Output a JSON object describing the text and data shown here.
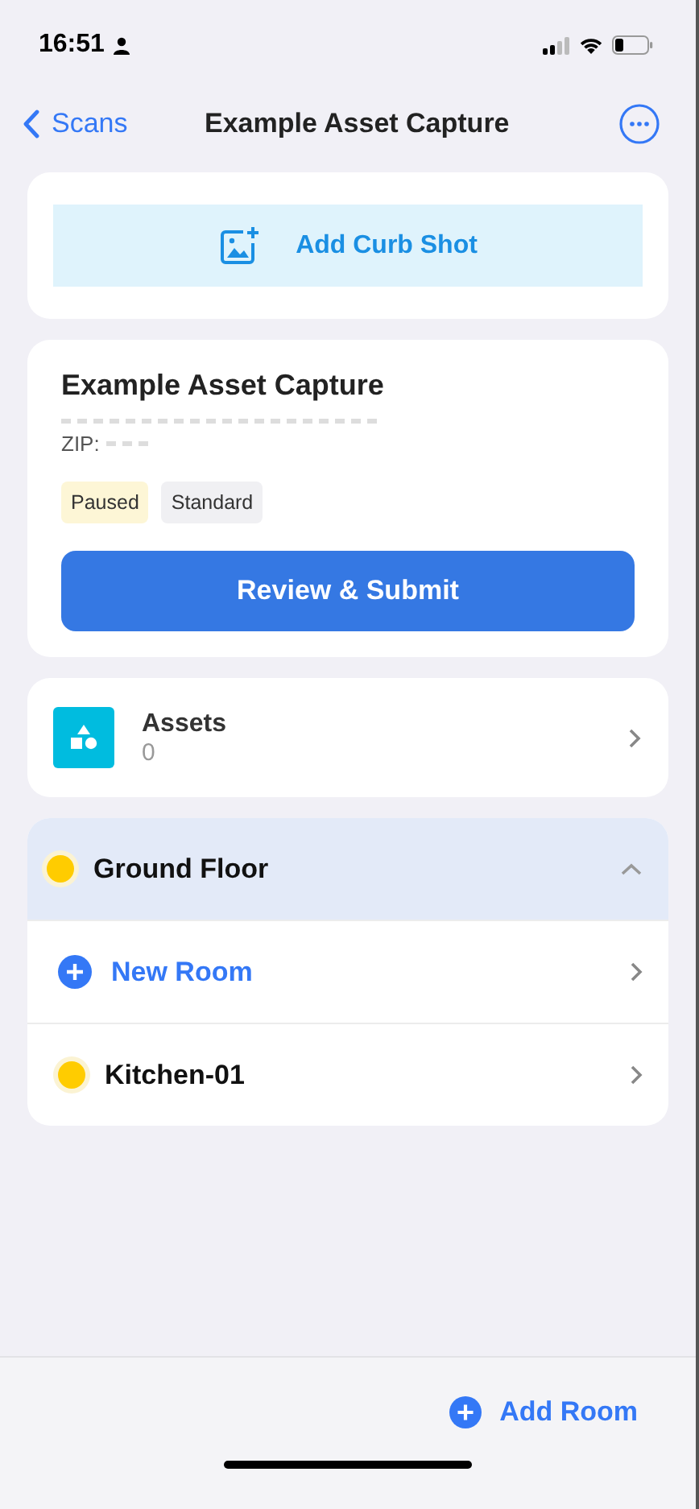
{
  "status_bar": {
    "time": "16:51"
  },
  "nav": {
    "back_label": "Scans",
    "title": "Example Asset Capture"
  },
  "curb_shot": {
    "label": "Add Curb Shot"
  },
  "scan": {
    "title": "Example Asset Capture",
    "zip_label": "ZIP:",
    "tags": [
      {
        "label": "Paused",
        "kind": "status"
      },
      {
        "label": "Standard",
        "kind": "plain"
      }
    ],
    "submit_label": "Review & Submit"
  },
  "assets": {
    "label": "Assets",
    "count": "0"
  },
  "floor": {
    "name": "Ground Floor",
    "color": "#ffcc00",
    "expanded": true,
    "rooms": [
      {
        "kind": "new",
        "label": "New Room"
      },
      {
        "kind": "room",
        "label": "Kitchen-01",
        "color": "#ffcc00"
      }
    ]
  },
  "bottom_bar": {
    "add_label": "Add Room"
  }
}
